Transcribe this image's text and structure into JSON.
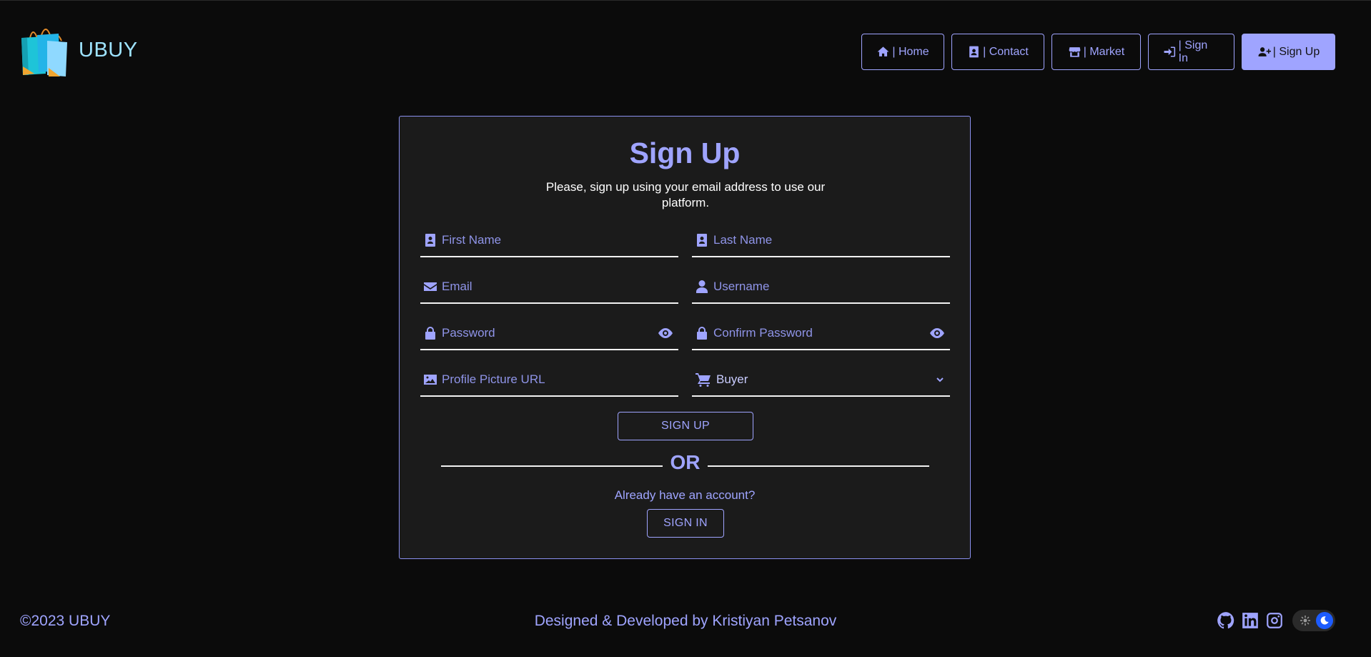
{
  "brand": {
    "name": "UBUY"
  },
  "nav": {
    "items": [
      {
        "label": "| Home",
        "icon": "home-icon"
      },
      {
        "label": "| Contact",
        "icon": "contact-card-icon"
      },
      {
        "label": "| Market",
        "icon": "store-icon"
      },
      {
        "label": "| Sign In",
        "icon": "sign-in-icon"
      },
      {
        "label": "| Sign Up",
        "icon": "user-plus-icon",
        "active": true
      }
    ]
  },
  "form": {
    "title": "Sign Up",
    "subtitle": "Please, sign up using your email address to use our platform.",
    "fields": {
      "first_name": {
        "placeholder": "First Name",
        "icon": "id-badge-icon"
      },
      "last_name": {
        "placeholder": "Last Name",
        "icon": "id-badge-icon"
      },
      "email": {
        "placeholder": "Email",
        "icon": "envelope-icon"
      },
      "username": {
        "placeholder": "Username",
        "icon": "user-icon"
      },
      "password": {
        "placeholder": "Password",
        "icon": "lock-icon"
      },
      "confirm_password": {
        "placeholder": "Confirm Password",
        "icon": "lock-icon"
      },
      "profile_picture": {
        "placeholder": "Profile Picture URL",
        "icon": "image-icon"
      },
      "role": {
        "value": "Buyer",
        "icon": "cart-icon"
      }
    },
    "submit_label": "SIGN UP",
    "or_label": "OR",
    "already_text": "Already have an account?",
    "signin_label": "SIGN IN"
  },
  "footer": {
    "copyright": "©2023 UBUY",
    "credit": "Designed & Developed by Kristiyan Petsanov",
    "social": [
      "github-icon",
      "linkedin-icon",
      "instagram-icon"
    ],
    "theme": "dark"
  },
  "colors": {
    "accent": "#9fa4ff",
    "background": "#0b0b0b",
    "card": "#1b1b1b",
    "toggle_knob": "#1d5cff"
  }
}
